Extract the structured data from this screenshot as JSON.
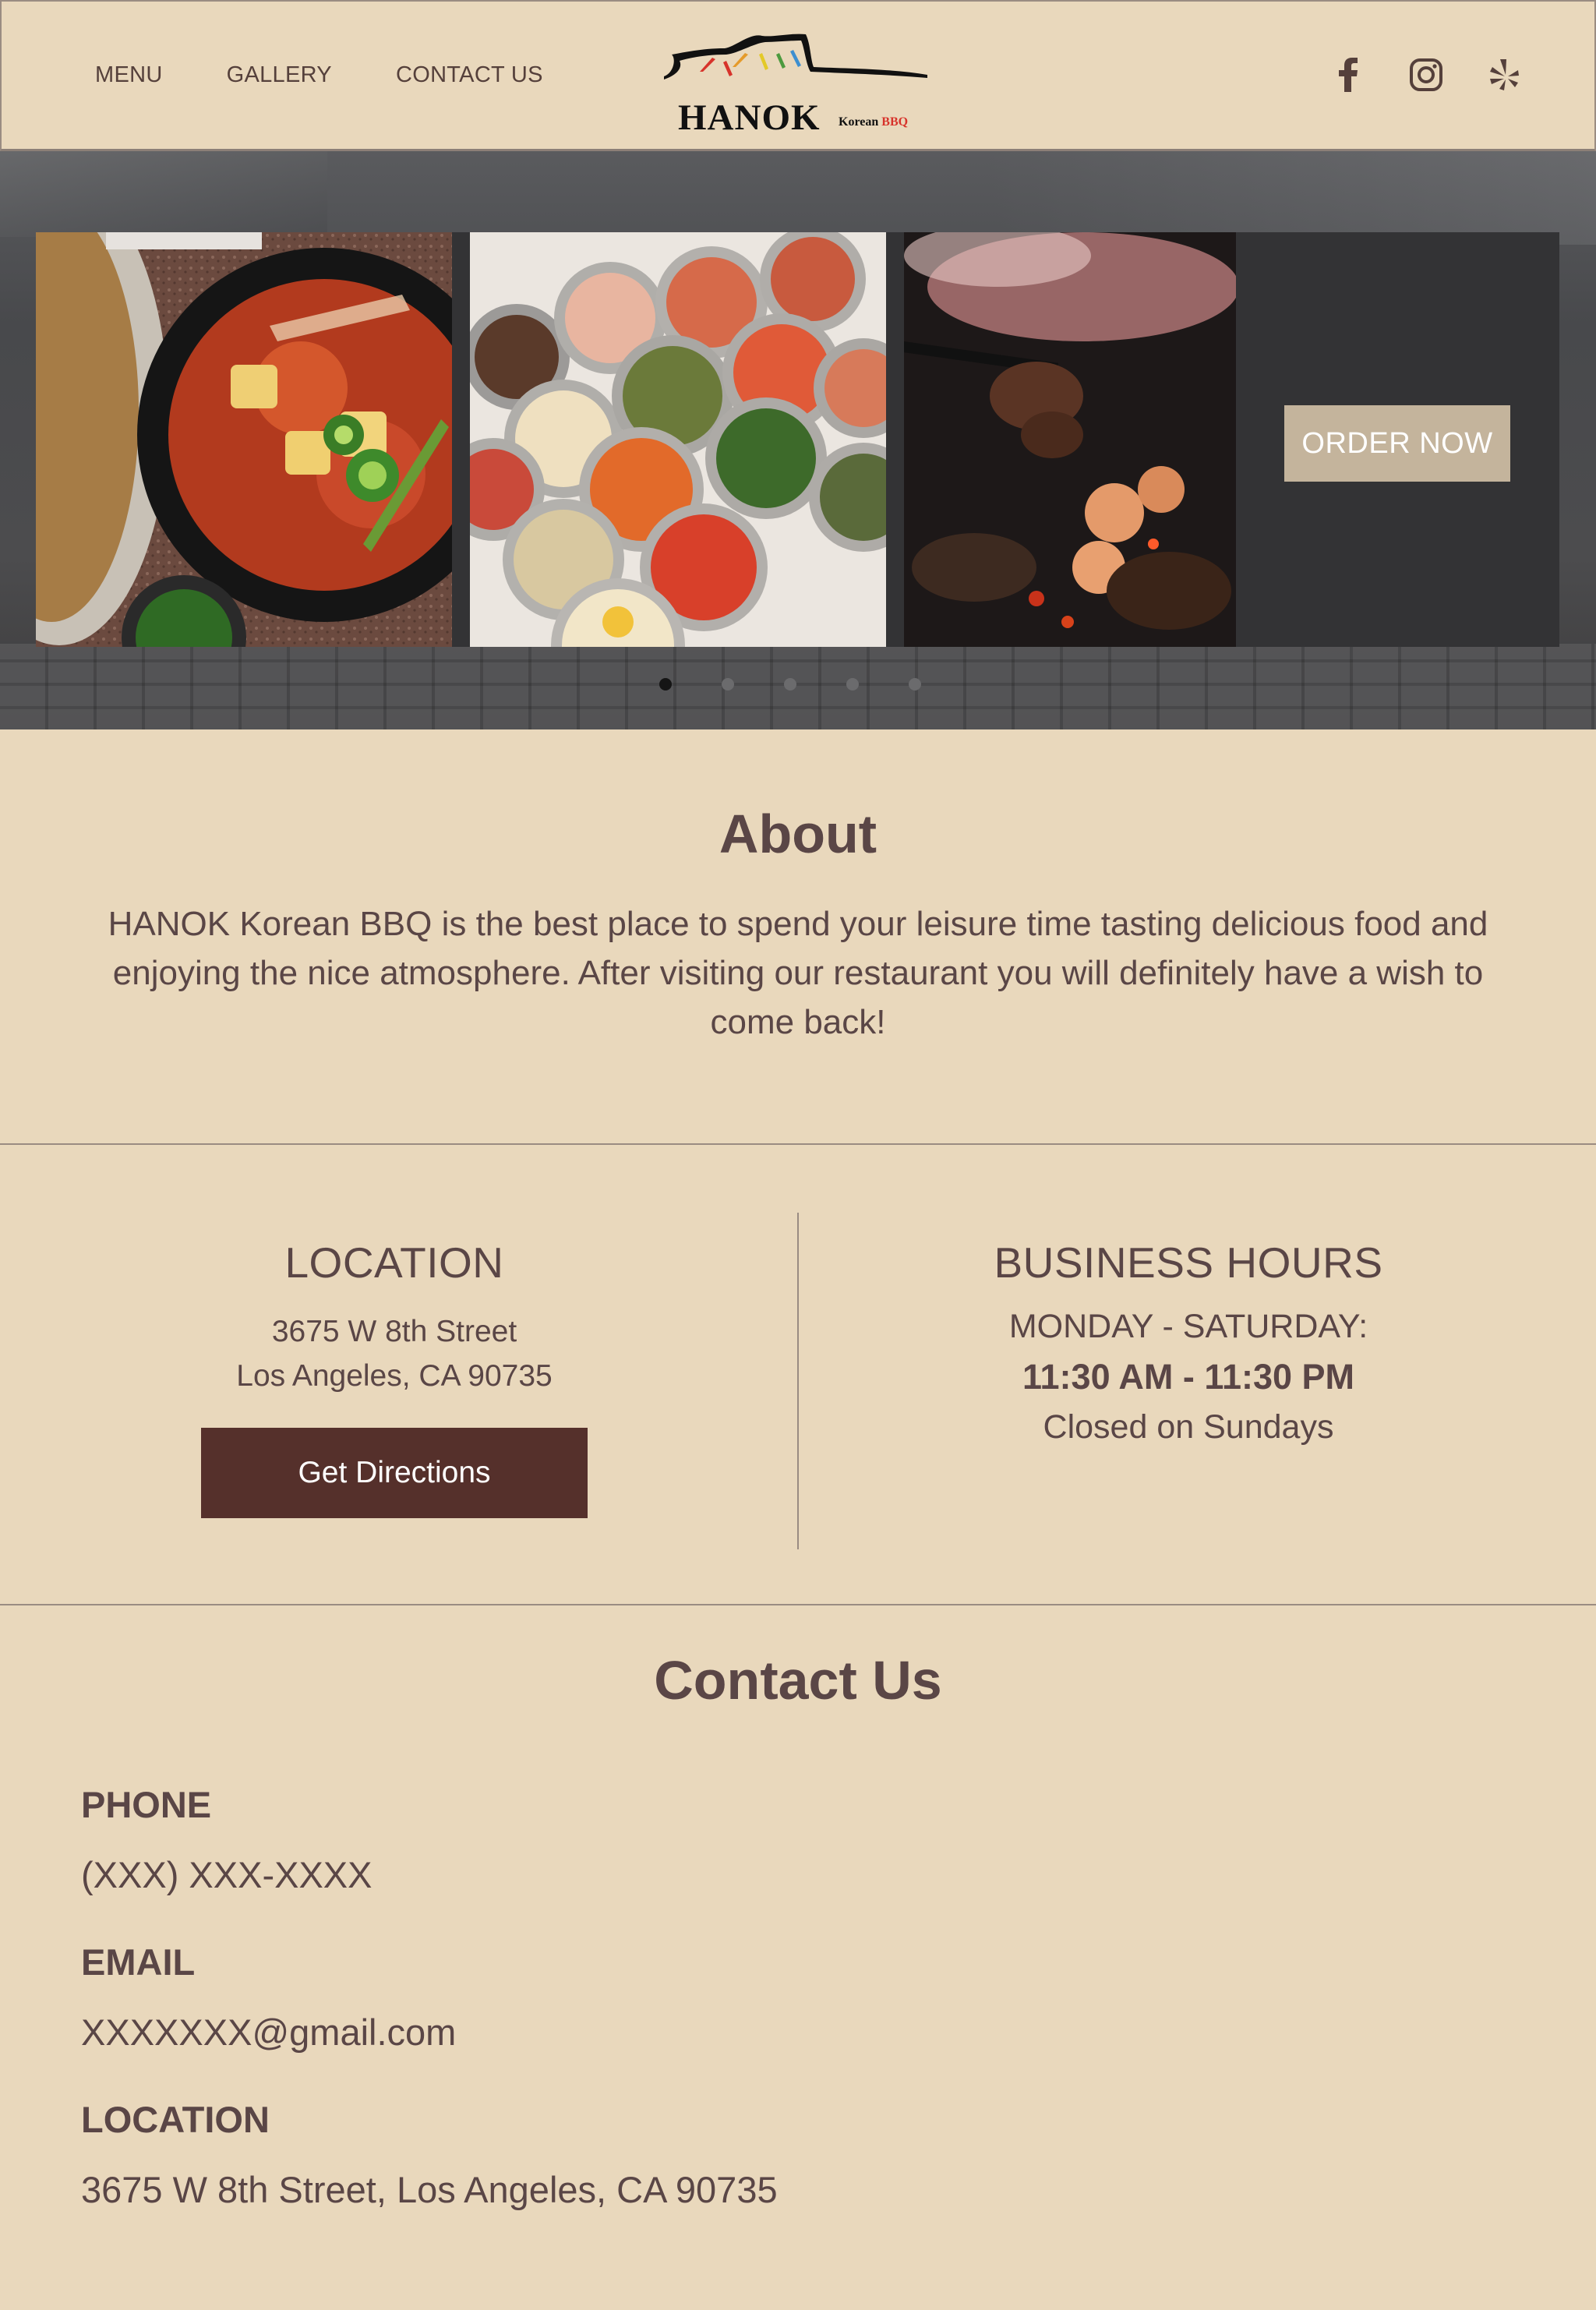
{
  "nav": {
    "items": [
      {
        "label": "MENU"
      },
      {
        "label": "GALLERY"
      },
      {
        "label": "CONTACT US"
      }
    ]
  },
  "logo": {
    "name": "HANOK",
    "sub_korean": "Korean",
    "sub_bbq": "BBQ"
  },
  "social": [
    "facebook-icon",
    "instagram-icon",
    "yelp-icon"
  ],
  "hero": {
    "slides": [
      "kimchi-stew-photo",
      "banchan-side-dishes-photo",
      "grilled-bbq-meat-photo"
    ],
    "order_button": "ORDER NOW",
    "slide_count": 5,
    "active_slide": 1
  },
  "about": {
    "title": "About",
    "text": "HANOK Korean BBQ is the best place to spend your leisure time tasting delicious food and enjoying the nice atmosphere. After visiting our restaurant you will definitely have a wish to come back!"
  },
  "location": {
    "title": "LOCATION",
    "address_line1": "3675 W 8th Street",
    "address_line2": "Los Angeles, CA 90735",
    "button": "Get Directions"
  },
  "hours": {
    "title": "BUSINESS HOURS",
    "days": "MONDAY - SATURDAY:",
    "time": "11:30 AM - 11:30 PM",
    "closed": "Closed on Sundays"
  },
  "contact": {
    "title": "Contact Us",
    "phone_label": "PHONE",
    "phone": "(XXX) XXX-XXXX",
    "email_label": "EMAIL",
    "email": "XXXXXXX@gmail.com",
    "location_label": "LOCATION",
    "location": "3675 W 8th Street, Los Angeles, CA 90735"
  },
  "colors": {
    "background": "#e9d8bc",
    "text": "#5a4646",
    "button_dark": "#55302b",
    "order_button": "#c4b49c"
  }
}
